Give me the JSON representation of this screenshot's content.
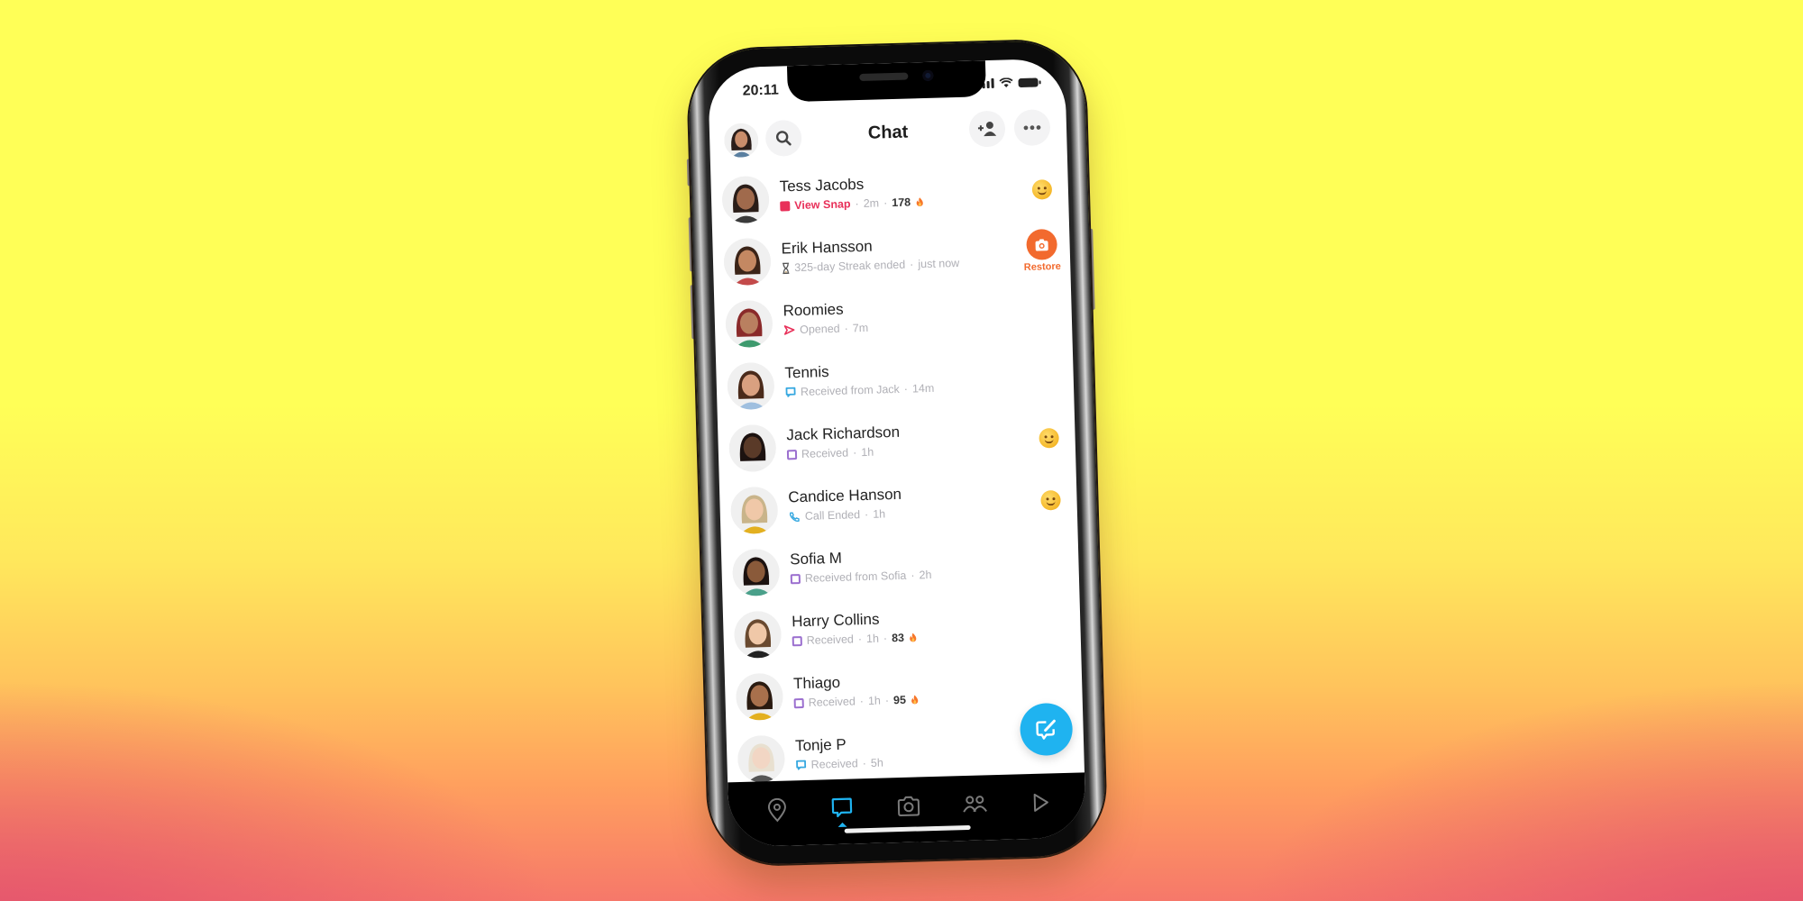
{
  "status_bar": {
    "time": "20:11"
  },
  "header": {
    "title": "Chat"
  },
  "colors": {
    "accent_blue": "#1fb3f0",
    "snap_red": "#e8315a",
    "restore_orange": "#f26a2e",
    "received_purple": "#9b6fcf",
    "chat_blue": "#36a8e0"
  },
  "chats": [
    {
      "name": "Tess Jacobs",
      "status_icon": "red-filled-square",
      "status": "View Snap",
      "time": "2m",
      "streak": "178",
      "streak_icon": "fire",
      "right": "smile-emoji"
    },
    {
      "name": "Erik Hansson",
      "status_icon": "hourglass",
      "status": "325-day Streak ended",
      "time": "just now",
      "right": "restore",
      "restore_label": "Restore"
    },
    {
      "name": "Roomies",
      "status_icon": "opened-arrow",
      "status": "Opened",
      "time": "7m"
    },
    {
      "name": "Tennis",
      "status_icon": "blue-chat-bubble",
      "status": "Received from Jack",
      "time": "14m"
    },
    {
      "name": "Jack Richardson",
      "status_icon": "purple-square-outline",
      "status": "Received",
      "time": "1h",
      "right": "smile-emoji"
    },
    {
      "name": "Candice Hanson",
      "status_icon": "phone",
      "status": "Call Ended",
      "time": "1h",
      "right": "smile-emoji"
    },
    {
      "name": "Sofia M",
      "status_icon": "purple-square-outline",
      "status": "Received from Sofia",
      "time": "2h"
    },
    {
      "name": "Harry Collins",
      "status_icon": "purple-square-outline",
      "status": "Received",
      "time": "1h",
      "streak": "83",
      "streak_icon": "fire"
    },
    {
      "name": "Thiago",
      "status_icon": "purple-square-outline",
      "status": "Received",
      "time": "1h",
      "streak": "95",
      "streak_icon": "fire"
    },
    {
      "name": "Tonje P",
      "status_icon": "blue-chat-bubble",
      "status": "Received",
      "time": "5h"
    }
  ],
  "tabs": [
    {
      "name": "map",
      "icon": "map-pin-icon"
    },
    {
      "name": "chat",
      "icon": "chat-icon",
      "active": true
    },
    {
      "name": "camera",
      "icon": "camera-icon"
    },
    {
      "name": "stories",
      "icon": "friends-icon"
    },
    {
      "name": "spotlight",
      "icon": "play-icon"
    }
  ],
  "separator": " · "
}
